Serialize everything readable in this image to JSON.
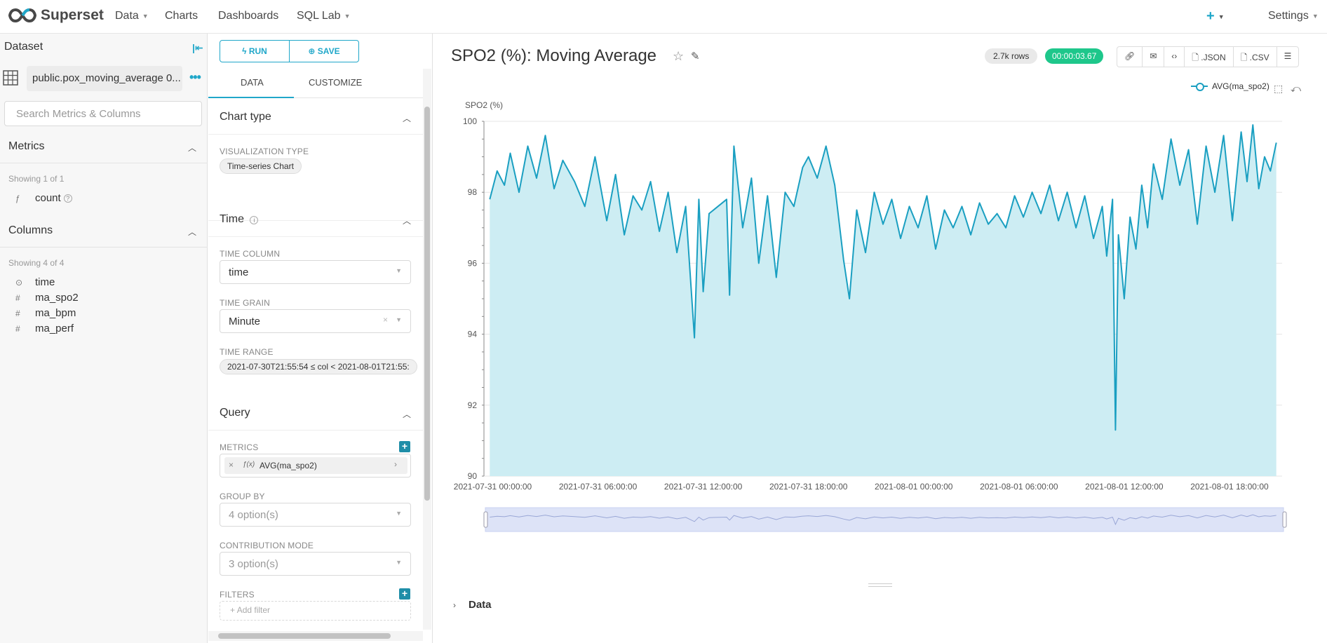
{
  "app": {
    "brand": "Superset",
    "nav": [
      {
        "label": "Data",
        "has_caret": true
      },
      {
        "label": "Charts",
        "has_caret": false
      },
      {
        "label": "Dashboards",
        "has_caret": false
      },
      {
        "label": "SQL Lab",
        "has_caret": true
      }
    ],
    "settings_label": "Settings",
    "plus_label": "+"
  },
  "dataset_panel": {
    "title": "Dataset",
    "dataset_name": "public.pox_moving_average 0...",
    "search_placeholder": "Search Metrics & Columns",
    "metrics": {
      "title": "Metrics",
      "showing": "Showing 1 of 1",
      "items": [
        {
          "type": "ƒ",
          "name": "count"
        }
      ]
    },
    "columns": {
      "title": "Columns",
      "showing": "Showing 4 of 4",
      "items": [
        {
          "type": "⊙",
          "name": "time"
        },
        {
          "type": "#",
          "name": "ma_spo2"
        },
        {
          "type": "#",
          "name": "ma_bpm"
        },
        {
          "type": "#",
          "name": "ma_perf"
        }
      ]
    }
  },
  "control_panel": {
    "run_label": "RUN",
    "save_label": "SAVE",
    "tabs": [
      "DATA",
      "CUSTOMIZE"
    ],
    "chart_type_section": "Chart type",
    "viz_type_label": "VISUALIZATION TYPE",
    "viz_type_value": "Time-series Chart",
    "time_section": "Time",
    "time_column_label": "TIME COLUMN",
    "time_column_value": "time",
    "time_grain_label": "TIME GRAIN",
    "time_grain_value": "Minute",
    "time_range_label": "TIME RANGE",
    "time_range_value": "2021-07-30T21:55:54 ≤ col < 2021-08-01T21:55:",
    "query_section": "Query",
    "metrics_label": "METRICS",
    "metric_value": "AVG(ma_spo2)",
    "group_by_label": "GROUP BY",
    "group_by_value": "4 option(s)",
    "contribution_label": "CONTRIBUTION MODE",
    "contribution_value": "3 option(s)",
    "filters_label": "FILTERS",
    "add_filter": "Add filter"
  },
  "chart_panel": {
    "title": "SPO2 (%): Moving Average",
    "rows_badge": "2.7k rows",
    "time_badge": "00:00:03.67",
    "actions": {
      "json": ".JSON",
      "csv": ".CSV"
    },
    "data_section": "Data"
  },
  "colors": {
    "accent": "#20a7c9",
    "series": "#1a9fc1",
    "area": "#cdedf3",
    "success": "#1ec78b"
  },
  "chart_data": {
    "type": "area",
    "ylabel": "SPO2 (%)",
    "ylim": [
      90,
      100
    ],
    "yticks": [
      "100",
      "98",
      "96",
      "94",
      "92",
      "90"
    ],
    "xticks": [
      "2021-07-31 00:00:00",
      "2021-07-31 06:00:00",
      "2021-07-31 12:00:00",
      "2021-07-31 18:00:00",
      "2021-08-01 00:00:00",
      "2021-08-01 06:00:00",
      "2021-08-01 12:00:00",
      "2021-08-01 18:00:00"
    ],
    "x_hours_note": "",
    "grid": true,
    "legend_position": "top-right",
    "series": [
      {
        "name": "AVG(ma_spo2)",
        "points": [
          [
            "2021-07-30 23:50",
            97.8
          ],
          [
            "2021-07-31 00:15",
            98.6
          ],
          [
            "2021-07-31 00:40",
            98.2
          ],
          [
            "2021-07-31 01:00",
            99.1
          ],
          [
            "2021-07-31 01:30",
            98.0
          ],
          [
            "2021-07-31 02:00",
            99.3
          ],
          [
            "2021-07-31 02:30",
            98.4
          ],
          [
            "2021-07-31 03:00",
            99.6
          ],
          [
            "2021-07-31 03:30",
            98.1
          ],
          [
            "2021-07-31 04:00",
            98.9
          ],
          [
            "2021-07-31 04:40",
            98.3
          ],
          [
            "2021-07-31 05:15",
            97.6
          ],
          [
            "2021-07-31 05:50",
            99.0
          ],
          [
            "2021-07-31 06:30",
            97.2
          ],
          [
            "2021-07-31 07:00",
            98.5
          ],
          [
            "2021-07-31 07:30",
            96.8
          ],
          [
            "2021-07-31 08:00",
            97.9
          ],
          [
            "2021-07-31 08:30",
            97.5
          ],
          [
            "2021-07-31 09:00",
            98.3
          ],
          [
            "2021-07-31 09:30",
            96.9
          ],
          [
            "2021-07-31 10:00",
            98.0
          ],
          [
            "2021-07-31 10:30",
            96.3
          ],
          [
            "2021-07-31 11:00",
            97.6
          ],
          [
            "2021-07-31 11:30",
            93.9
          ],
          [
            "2021-07-31 11:45",
            97.8
          ],
          [
            "2021-07-31 12:00",
            95.2
          ],
          [
            "2021-07-31 12:20",
            97.4
          ],
          [
            "2021-07-31 13:20",
            97.8
          ],
          [
            "2021-07-31 13:30",
            95.1
          ],
          [
            "2021-07-31 13:45",
            99.3
          ],
          [
            "2021-07-31 14:15",
            97.0
          ],
          [
            "2021-07-31 14:45",
            98.4
          ],
          [
            "2021-07-31 15:10",
            96.0
          ],
          [
            "2021-07-31 15:40",
            97.9
          ],
          [
            "2021-07-31 16:10",
            95.6
          ],
          [
            "2021-07-31 16:40",
            98.0
          ],
          [
            "2021-07-31 17:10",
            97.6
          ],
          [
            "2021-07-31 17:40",
            98.7
          ],
          [
            "2021-07-31 18:00",
            99.0
          ],
          [
            "2021-07-31 18:30",
            98.4
          ],
          [
            "2021-07-31 19:00",
            99.3
          ],
          [
            "2021-07-31 19:30",
            98.2
          ],
          [
            "2021-07-31 20:00",
            96.1
          ],
          [
            "2021-07-31 20:20",
            95.0
          ],
          [
            "2021-07-31 20:45",
            97.5
          ],
          [
            "2021-07-31 21:15",
            96.3
          ],
          [
            "2021-07-31 21:45",
            98.0
          ],
          [
            "2021-07-31 22:15",
            97.1
          ],
          [
            "2021-07-31 22:45",
            97.8
          ],
          [
            "2021-07-31 23:15",
            96.7
          ],
          [
            "2021-07-31 23:45",
            97.6
          ],
          [
            "2021-08-01 00:15",
            97.0
          ],
          [
            "2021-08-01 00:45",
            97.9
          ],
          [
            "2021-08-01 01:15",
            96.4
          ],
          [
            "2021-08-01 01:45",
            97.5
          ],
          [
            "2021-08-01 02:15",
            97.0
          ],
          [
            "2021-08-01 02:45",
            97.6
          ],
          [
            "2021-08-01 03:15",
            96.8
          ],
          [
            "2021-08-01 03:45",
            97.7
          ],
          [
            "2021-08-01 04:15",
            97.1
          ],
          [
            "2021-08-01 04:45",
            97.4
          ],
          [
            "2021-08-01 05:15",
            97.0
          ],
          [
            "2021-08-01 05:45",
            97.9
          ],
          [
            "2021-08-01 06:15",
            97.3
          ],
          [
            "2021-08-01 06:45",
            98.0
          ],
          [
            "2021-08-01 07:15",
            97.4
          ],
          [
            "2021-08-01 07:45",
            98.2
          ],
          [
            "2021-08-01 08:15",
            97.2
          ],
          [
            "2021-08-01 08:45",
            98.0
          ],
          [
            "2021-08-01 09:15",
            97.0
          ],
          [
            "2021-08-01 09:45",
            97.9
          ],
          [
            "2021-08-01 10:15",
            96.7
          ],
          [
            "2021-08-01 10:45",
            97.6
          ],
          [
            "2021-08-01 11:00",
            96.2
          ],
          [
            "2021-08-01 11:20",
            97.8
          ],
          [
            "2021-08-01 11:30",
            91.3
          ],
          [
            "2021-08-01 11:40",
            96.8
          ],
          [
            "2021-08-01 12:00",
            95.0
          ],
          [
            "2021-08-01 12:20",
            97.3
          ],
          [
            "2021-08-01 12:40",
            96.4
          ],
          [
            "2021-08-01 13:00",
            98.2
          ],
          [
            "2021-08-01 13:20",
            97.0
          ],
          [
            "2021-08-01 13:40",
            98.8
          ],
          [
            "2021-08-01 14:10",
            97.8
          ],
          [
            "2021-08-01 14:40",
            99.5
          ],
          [
            "2021-08-01 15:10",
            98.2
          ],
          [
            "2021-08-01 15:40",
            99.2
          ],
          [
            "2021-08-01 16:10",
            97.1
          ],
          [
            "2021-08-01 16:40",
            99.3
          ],
          [
            "2021-08-01 17:10",
            98.0
          ],
          [
            "2021-08-01 17:40",
            99.6
          ],
          [
            "2021-08-01 18:10",
            97.2
          ],
          [
            "2021-08-01 18:40",
            99.7
          ],
          [
            "2021-08-01 19:00",
            98.3
          ],
          [
            "2021-08-01 19:20",
            99.9
          ],
          [
            "2021-08-01 19:40",
            98.1
          ],
          [
            "2021-08-01 20:00",
            99.0
          ],
          [
            "2021-08-01 20:20",
            98.6
          ],
          [
            "2021-08-01 20:40",
            99.4
          ]
        ]
      }
    ]
  }
}
